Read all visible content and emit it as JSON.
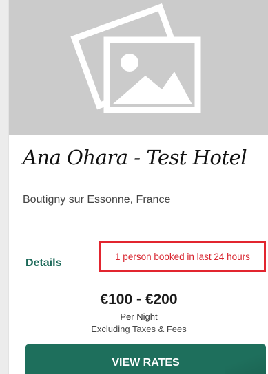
{
  "hotel": {
    "image_icon": "photo-placeholder-icon",
    "name": "Ana Ohara - Test Hotel",
    "location": "Boutigny sur Essonne, France"
  },
  "details": {
    "label": "Details"
  },
  "booking_notice": {
    "text": "1 person booked in last 24 hours",
    "color": "#d8252f",
    "highlight_color": "#e2252f"
  },
  "price": {
    "range": "€100 - €200",
    "per_night": "Per Night",
    "note": "Excluding Taxes & Fees"
  },
  "view_rates_button": {
    "label": "VIEW RATES",
    "color": "#1e6f5c"
  },
  "colors": {
    "accent": "#1d6a5a",
    "image_placeholder": "#cbcbcb"
  }
}
